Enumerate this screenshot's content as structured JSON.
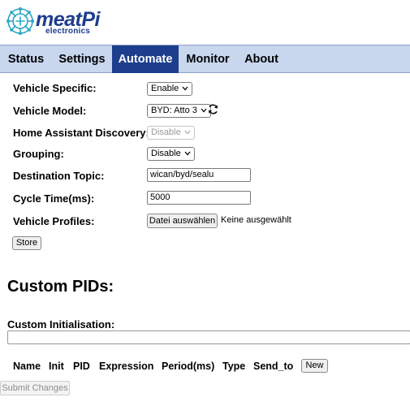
{
  "logo": {
    "brand": "meatPi",
    "sub": "electronics"
  },
  "nav": {
    "tabs": [
      {
        "label": "Status"
      },
      {
        "label": "Settings"
      },
      {
        "label": "Automate"
      },
      {
        "label": "Monitor"
      },
      {
        "label": "About"
      }
    ],
    "active": "Automate"
  },
  "form": {
    "vehicle_specific": {
      "label": "Vehicle Specific:",
      "value": "Enable"
    },
    "vehicle_model": {
      "label": "Vehicle Model:",
      "value": "BYD: Atto 3"
    },
    "ha_discovery": {
      "label": "Home Assistant Discovery:",
      "value": "Disable"
    },
    "grouping": {
      "label": "Grouping:",
      "value": "Disable"
    },
    "destination_topic": {
      "label": "Destination Topic:",
      "value": "wican/byd/sealu"
    },
    "cycle_time": {
      "label": "Cycle Time(ms):",
      "value": "5000"
    },
    "vehicle_profiles": {
      "label": "Vehicle Profiles:",
      "button": "Datei auswählen",
      "status": "Keine ausgewählt"
    },
    "store_button": "Store"
  },
  "custom_pids": {
    "heading": "Custom PIDs:",
    "init_label": "Custom Initialisation:",
    "init_value": "",
    "columns": [
      "Name",
      "Init",
      "PID",
      "Expression",
      "Period(ms)",
      "Type",
      "Send_to"
    ],
    "new_button": "New"
  },
  "submit_button": "Submit Changes",
  "colors": {
    "nav_bg": "#c8d6ee",
    "nav_active": "#1c3e8c",
    "logo": "#1f3c8c",
    "logo_icon": "#2aa7c4"
  }
}
